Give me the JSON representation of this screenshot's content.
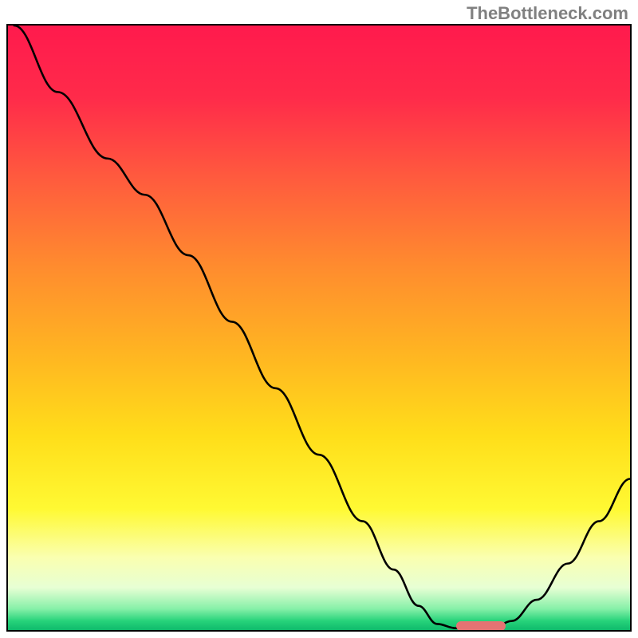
{
  "watermark": "TheBottleneck.com",
  "gradient_stops": [
    {
      "offset": 0.0,
      "color": "#ff1a4d"
    },
    {
      "offset": 0.12,
      "color": "#ff2b4a"
    },
    {
      "offset": 0.25,
      "color": "#ff5a3e"
    },
    {
      "offset": 0.4,
      "color": "#ff8c2e"
    },
    {
      "offset": 0.55,
      "color": "#ffb721"
    },
    {
      "offset": 0.68,
      "color": "#ffde1a"
    },
    {
      "offset": 0.8,
      "color": "#fff933"
    },
    {
      "offset": 0.88,
      "color": "#faffb0"
    },
    {
      "offset": 0.93,
      "color": "#e7ffd4"
    },
    {
      "offset": 0.965,
      "color": "#86f0a8"
    },
    {
      "offset": 0.985,
      "color": "#27d37a"
    },
    {
      "offset": 1.0,
      "color": "#0fba6c"
    }
  ],
  "chart_data": {
    "type": "line",
    "title": "",
    "xlabel": "",
    "ylabel": "",
    "xlim": [
      0,
      100
    ],
    "ylim": [
      0,
      100
    ],
    "series": [
      {
        "name": "curve",
        "points": [
          {
            "x": 1,
            "y": 100
          },
          {
            "x": 8,
            "y": 89
          },
          {
            "x": 16,
            "y": 78
          },
          {
            "x": 22,
            "y": 72
          },
          {
            "x": 29,
            "y": 62
          },
          {
            "x": 36,
            "y": 51
          },
          {
            "x": 43,
            "y": 40
          },
          {
            "x": 50,
            "y": 29
          },
          {
            "x": 57,
            "y": 18
          },
          {
            "x": 62,
            "y": 10
          },
          {
            "x": 66,
            "y": 4
          },
          {
            "x": 69,
            "y": 1
          },
          {
            "x": 72,
            "y": 0.3
          },
          {
            "x": 78,
            "y": 0.3
          },
          {
            "x": 81,
            "y": 1.5
          },
          {
            "x": 85,
            "y": 5
          },
          {
            "x": 90,
            "y": 11
          },
          {
            "x": 95,
            "y": 18
          },
          {
            "x": 100,
            "y": 25
          }
        ]
      }
    ],
    "marker": {
      "x_start": 72,
      "x_end": 80,
      "y": 0.7,
      "color": "#e57373"
    }
  },
  "frame": {
    "inner_width": 780,
    "inner_height": 758
  }
}
